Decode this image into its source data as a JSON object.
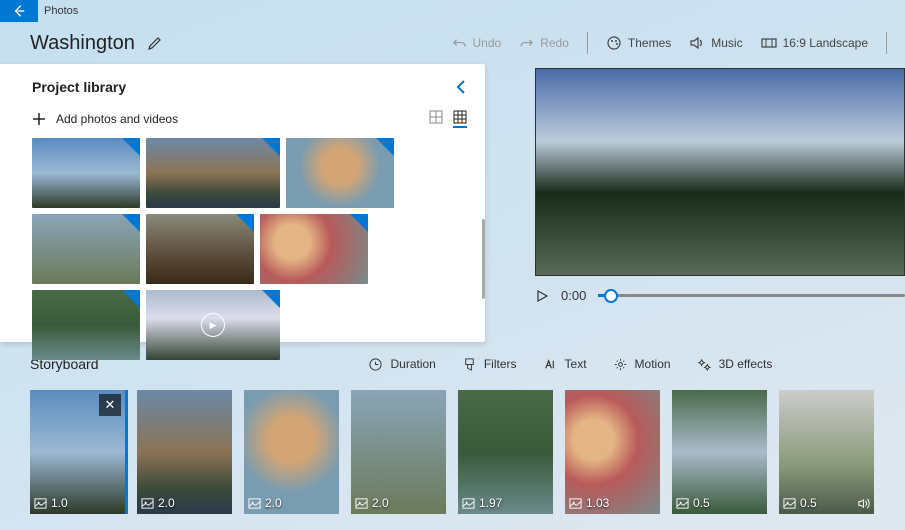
{
  "app": {
    "name": "Photos"
  },
  "project": {
    "title": "Washington"
  },
  "header_actions": {
    "undo": "Undo",
    "redo": "Redo",
    "themes": "Themes",
    "music": "Music",
    "aspect": "16:9 Landscape"
  },
  "library": {
    "title": "Project library",
    "add_label": "Add photos and videos",
    "items": [
      {
        "kind": "photo",
        "style": "sky"
      },
      {
        "kind": "photo",
        "style": "mtn",
        "wide": true
      },
      {
        "kind": "photo",
        "style": "face"
      },
      {
        "kind": "photo",
        "style": "group"
      },
      {
        "kind": "photo",
        "style": "rocks"
      },
      {
        "kind": "photo",
        "style": "selfie"
      },
      {
        "kind": "photo",
        "style": "forest"
      },
      {
        "kind": "video",
        "style": "snow",
        "wide": true
      }
    ]
  },
  "preview": {
    "time": "0:00"
  },
  "storyboard": {
    "title": "Storyboard",
    "tools": {
      "duration": "Duration",
      "filters": "Filters",
      "text": "Text",
      "motion": "Motion",
      "effects": "3D effects"
    },
    "clips": [
      {
        "duration": "1.0",
        "style": "sky",
        "selected": true
      },
      {
        "duration": "2.0",
        "style": "mtn"
      },
      {
        "duration": "2.0",
        "style": "face"
      },
      {
        "duration": "2.0",
        "style": "group"
      },
      {
        "duration": "1.97",
        "style": "forest"
      },
      {
        "duration": "1.03",
        "style": "selfie"
      },
      {
        "duration": "0.5",
        "style": "creek"
      },
      {
        "duration": "0.5",
        "style": "hikers",
        "sound": true
      }
    ]
  }
}
